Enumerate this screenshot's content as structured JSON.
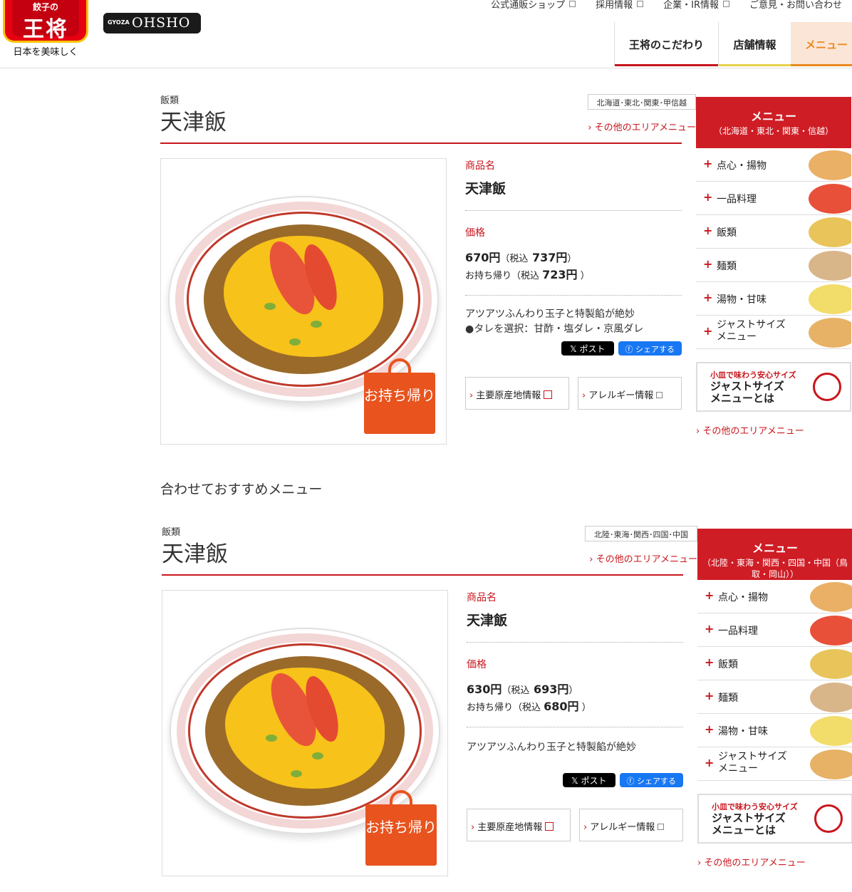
{
  "header": {
    "logo_small": "餃子の",
    "logo_main": "王将",
    "tagline": "日本を美味しく",
    "ohsho_gyoza": "GYOZA",
    "ohsho_name": "OHSHO",
    "top_links": [
      "公式通販ショップ",
      "採用情報",
      "企業・IR情報",
      "ご意見・お問い合わせ"
    ],
    "nav": [
      {
        "label": "王将のこだわり",
        "color": "#c8161d"
      },
      {
        "label": "店舗情報",
        "color": "#e6d24a"
      },
      {
        "label": "メニュー",
        "color": "#ea8a1f"
      }
    ]
  },
  "sections": [
    {
      "category": "飯類",
      "title": "天津飯",
      "area_badge": "北海道･東北･関東･甲信越",
      "area_link": "その他のエリアメニュー",
      "takeout_badge": "お持ち帰り",
      "product_label": "商品名",
      "product_name": "天津飯",
      "price_label": "価格",
      "price": "670円",
      "tax_prefix": "（税込",
      "price_tax": "737円",
      "tax_suffix": "）",
      "takeout_prefix": "お持ち帰り（税込",
      "takeout_price": "723円",
      "desc1": "アツアツふんわり玉子と特製餡が絶妙",
      "desc2": "●タレを選択：甘酢・塩ダレ・京風ダレ",
      "x_button": "𝕏 ポスト",
      "fb_button": "シェアする",
      "origin_button": "主要原産地情報",
      "allergy_button": "アレルギー情報",
      "side_title": "メニュー",
      "side_sub": "（北海道・東北・関東・信越）",
      "side_items": [
        "点心・揚物",
        "一品料理",
        "飯類",
        "麺類",
        "湯物・甘味",
        "ジャストサイズ\nメニュー"
      ],
      "promo_small": "小皿で味わう安心サイズ",
      "promo_big": "ジャストサイズ\nメニューとは",
      "side_link": "その他のエリアメニュー"
    },
    {
      "category": "飯類",
      "title": "天津飯",
      "area_badge": "北陸･東海･関西･四国･中国",
      "area_link": "その他のエリアメニュー",
      "takeout_badge": "お持ち帰り",
      "product_label": "商品名",
      "product_name": "天津飯",
      "price_label": "価格",
      "price": "630円",
      "tax_prefix": "（税込",
      "price_tax": "693円",
      "tax_suffix": "）",
      "takeout_prefix": "お持ち帰り（税込",
      "takeout_price": "680円",
      "desc1": "アツアツふんわり玉子と特製餡が絶妙",
      "desc2": "",
      "x_button": "𝕏 ポスト",
      "fb_button": "シェアする",
      "origin_button": "主要原産地情報",
      "allergy_button": "アレルギー情報",
      "side_title": "メニュー",
      "side_sub": "（北陸・東海・関西・四国・中国（鳥取・岡山））",
      "side_items": [
        "点心・揚物",
        "一品料理",
        "飯類",
        "麺類",
        "湯物・甘味",
        "ジャストサイズ\nメニュー"
      ],
      "promo_small": "小皿で味わう安心サイズ",
      "promo_big": "ジャストサイズ\nメニューとは",
      "side_link": "その他のエリアメニュー"
    }
  ],
  "recommend_title": "合わせておすすめメニュー",
  "thumb_colors": [
    "#e9b066",
    "#e8503a",
    "#e8c45a",
    "#d9b58a",
    "#f2dc6a",
    "#e7b266"
  ]
}
